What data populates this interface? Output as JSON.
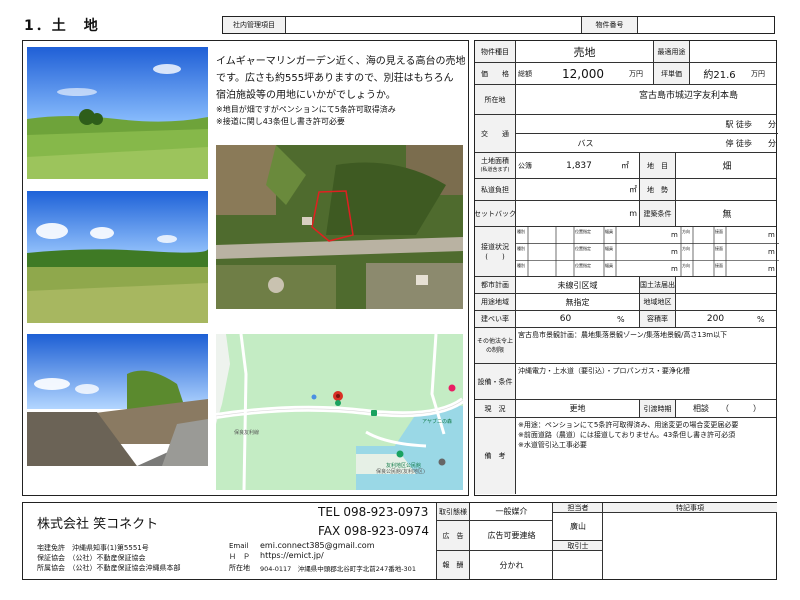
{
  "title": "1．土　地",
  "header": {
    "mgmt_label": "社内管理項目",
    "property_no_label": "物件番号"
  },
  "description": {
    "lines": [
      "イムギャーマリンガーデン近く、海の見える高台の売地",
      "です。広さも約555坪ありますので、別荘はもちろん",
      "宿泊施設等の用地にいかがでしょうか。"
    ],
    "notes": [
      "※地目が畑ですがペンションにて5条許可取得済み",
      "※接道に関し43条但し書き許可必要"
    ]
  },
  "map": {
    "poi_1": "アヤブニの森",
    "poi_2": "友利地区公民館",
    "poi_3": "保良公民館(友利地区)",
    "road": "保良友利線"
  },
  "info": {
    "type_label": "物件種目",
    "type_value": "売地",
    "best_use_label": "最適用途",
    "price_label": "価　　格",
    "price_total_label": "総額",
    "price_value": "12,000",
    "price_unit": "万円",
    "tsubo_label": "坪単価",
    "tsubo_value": "約21.6",
    "tsubo_unit": "万円",
    "location_label": "所在地",
    "location_value": "宮古島市城辺字友利本島",
    "transport_label": "交　　通",
    "station_text": "駅 徒歩　　分",
    "bus_label": "バス",
    "stop_text": "停 徒歩　　分",
    "land_area_label": "土地面積",
    "land_area_sub": "(私道含まず)",
    "land_area_kind": "公簿",
    "land_area_value": "1,837",
    "sqm": "㎡",
    "chimoku_label": "地　目",
    "chimoku_value": "畑",
    "private_road_label": "私道負担",
    "chisei_label": "地　勢",
    "setback_label": "セットバック",
    "m": "m",
    "build_cond_label": "建築条件",
    "build_cond_value": "無",
    "road_status_label": "接道状況",
    "road_status_paren": "(　　)",
    "road_cells": [
      "種別",
      "位置指定",
      "幅員",
      "方向",
      "接面"
    ],
    "city_plan_label": "都市計画",
    "city_plan_value": "未線引区域",
    "land_law_label": "国土法届出",
    "zoning_label": "用途地域",
    "zoning_value": "無指定",
    "district_label": "地域地区",
    "bcr_label": "建ぺい率",
    "bcr_value": "60",
    "far_label": "容積率",
    "far_value": "200",
    "pct": "%",
    "other_law_label": "その他法令上の制限",
    "other_law_value": "宮古島市景観計画：農地集落景観ゾーン/集落地景観/高さ13m以下",
    "facilities_label": "設備・条件",
    "facilities_value": "沖縄電力・上水道（要引込）・プロパンガス・要浄化槽",
    "status_label": "現　況",
    "status_value": "更地",
    "handover_label": "引渡時期",
    "handover_value": "相談　　（　　　）",
    "remarks_label": "備　考",
    "remarks": [
      "※用途：ペンションにて5条許可取得済み、用途変更の場合変更届必要",
      "※前面道路（農道）には接道しておりません。43条但し書き許可必須",
      "※水道管引込工事必要"
    ]
  },
  "footer": {
    "company": "株式会社 笑コネクト",
    "license": "宅建免許　沖縄県知事(1)第5551号",
    "guarantee": "保証協会　（公社）不動産保証協会",
    "member": "所属協会　（公社）不動産保証協会沖縄県本部",
    "tel": "TEL 098-923-0973",
    "fax": "FAX 098-923-0974",
    "email_label": "Email",
    "email": "emi.connect385@gmail.com",
    "hp_label": "Ｈ　Ｐ",
    "hp": "https://emict.jp/",
    "addr_label": "所在地",
    "addr": "904-0117　沖縄県中頭郡北谷町字北前247番地-301",
    "deal_label": "取引態様",
    "deal_value": "一般媒介",
    "ad_label": "広　告",
    "ad_value": "広告可要連絡",
    "fee_label": "報　酬",
    "fee_value": "分かれ",
    "agent_label": "担当者",
    "agent_value": "廣山",
    "dealer_label": "取引士",
    "special_label": "特記事項"
  }
}
